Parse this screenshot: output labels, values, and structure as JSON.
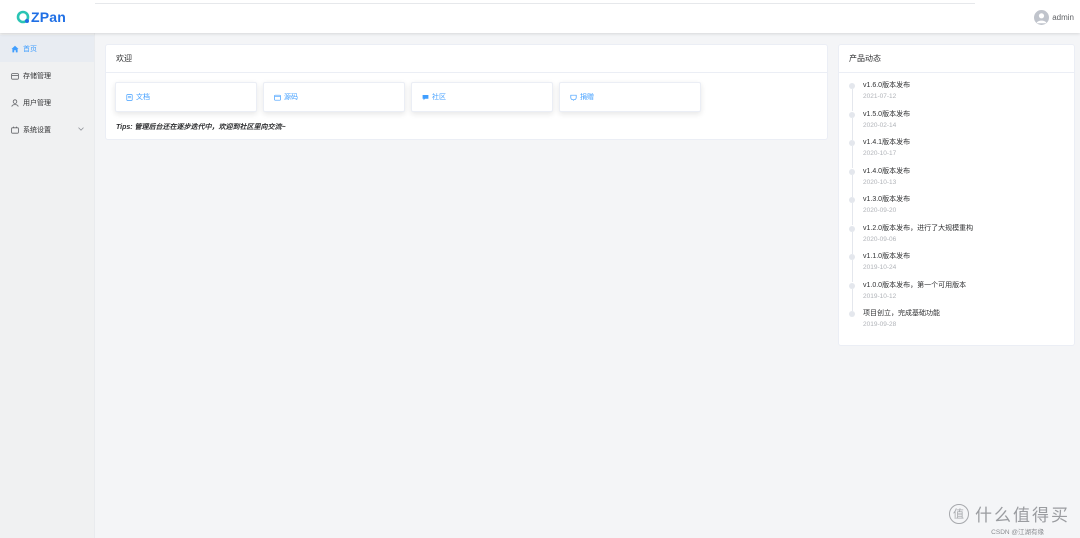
{
  "header": {
    "brand": "ZPan",
    "username": "admin"
  },
  "colors": {
    "accent": "#409eff",
    "brand": "#1f6fe5",
    "sidebar_bg": "#f0f1f2"
  },
  "sidebar": {
    "items": [
      {
        "label": "首页",
        "icon": "home-icon",
        "active": true
      },
      {
        "label": "存储管理",
        "icon": "storage-icon",
        "active": false
      },
      {
        "label": "用户管理",
        "icon": "user-icon",
        "active": false
      },
      {
        "label": "系统设置",
        "icon": "settings-icon",
        "active": false
      }
    ]
  },
  "welcome": {
    "title": "欢迎",
    "links": [
      {
        "label": "文档",
        "icon": "doc-icon"
      },
      {
        "label": "源码",
        "icon": "code-icon"
      },
      {
        "label": "社区",
        "icon": "chat-icon"
      },
      {
        "label": "捐赠",
        "icon": "donate-icon"
      }
    ],
    "tips": "Tips: 管理后台还在逐步迭代中，欢迎到社区里向交流~"
  },
  "news": {
    "title": "产品动态",
    "items": [
      {
        "title": "v1.6.0版本发布",
        "date": "2021-07-12"
      },
      {
        "title": "v1.5.0版本发布",
        "date": "2020-02-14"
      },
      {
        "title": "v1.4.1版本发布",
        "date": "2020-10-17"
      },
      {
        "title": "v1.4.0版本发布",
        "date": "2020-10-13"
      },
      {
        "title": "v1.3.0版本发布",
        "date": "2020-09-20"
      },
      {
        "title": "v1.2.0版本发布，进行了大规模重构",
        "date": "2020-09-06"
      },
      {
        "title": "v1.1.0版本发布",
        "date": "2019-10-24"
      },
      {
        "title": "v1.0.0版本发布，第一个可用版本",
        "date": "2019-10-12"
      },
      {
        "title": "项目创立，完成基础功能",
        "date": "2019-09-28"
      }
    ]
  },
  "watermark": {
    "site": "什么值得买",
    "csdn": "CSDN @江湖有缘"
  }
}
